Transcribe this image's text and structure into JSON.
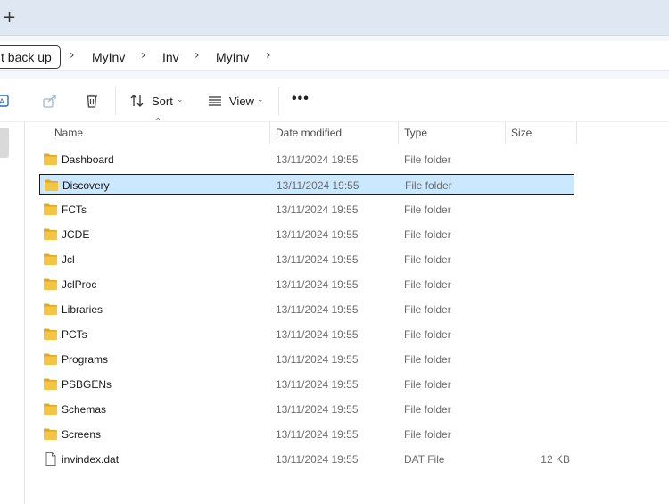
{
  "tabstrip": {
    "new_tab_glyph": "+"
  },
  "address": {
    "back_up_chip": "t back up",
    "crumbs": [
      "MyInv",
      "Inv",
      "MyInv"
    ],
    "chevron": "›"
  },
  "toolbar": {
    "sort_label": "Sort",
    "view_label": "View",
    "more_label": "•••",
    "icons": [
      "rename-icon",
      "share-icon",
      "delete-icon",
      "sort-icon",
      "view-icon"
    ]
  },
  "columns": {
    "name": "Name",
    "date_modified": "Date modified",
    "type": "Type",
    "size": "Size"
  },
  "files": [
    {
      "name": "Dashboard",
      "date": "13/11/2024 19:55",
      "type": "File folder",
      "size": "",
      "icon": "folder-icon"
    },
    {
      "name": "Discovery",
      "date": "13/11/2024 19:55",
      "type": "File folder",
      "size": "",
      "icon": "folder-icon",
      "selected": true
    },
    {
      "name": "FCTs",
      "date": "13/11/2024 19:55",
      "type": "File folder",
      "size": "",
      "icon": "folder-icon"
    },
    {
      "name": "JCDE",
      "date": "13/11/2024 19:55",
      "type": "File folder",
      "size": "",
      "icon": "folder-icon"
    },
    {
      "name": "Jcl",
      "date": "13/11/2024 19:55",
      "type": "File folder",
      "size": "",
      "icon": "folder-icon"
    },
    {
      "name": "JclProc",
      "date": "13/11/2024 19:55",
      "type": "File folder",
      "size": "",
      "icon": "folder-icon"
    },
    {
      "name": "Libraries",
      "date": "13/11/2024 19:55",
      "type": "File folder",
      "size": "",
      "icon": "folder-icon"
    },
    {
      "name": "PCTs",
      "date": "13/11/2024 19:55",
      "type": "File folder",
      "size": "",
      "icon": "folder-icon"
    },
    {
      "name": "Programs",
      "date": "13/11/2024 19:55",
      "type": "File folder",
      "size": "",
      "icon": "folder-icon"
    },
    {
      "name": "PSBGENs",
      "date": "13/11/2024 19:55",
      "type": "File folder",
      "size": "",
      "icon": "folder-icon"
    },
    {
      "name": "Schemas",
      "date": "13/11/2024 19:55",
      "type": "File folder",
      "size": "",
      "icon": "folder-icon"
    },
    {
      "name": "Screens",
      "date": "13/11/2024 19:55",
      "type": "File folder",
      "size": "",
      "icon": "folder-icon"
    },
    {
      "name": "invindex.dat",
      "date": "13/11/2024 19:55",
      "type": "DAT File",
      "size": "12 KB",
      "icon": "file-icon"
    }
  ],
  "colors": {
    "selection_bg": "#cce8ff",
    "folder_yellow": "#f4c542",
    "folder_dark": "#e0a820",
    "accent_blue": "#2b6cb0"
  }
}
